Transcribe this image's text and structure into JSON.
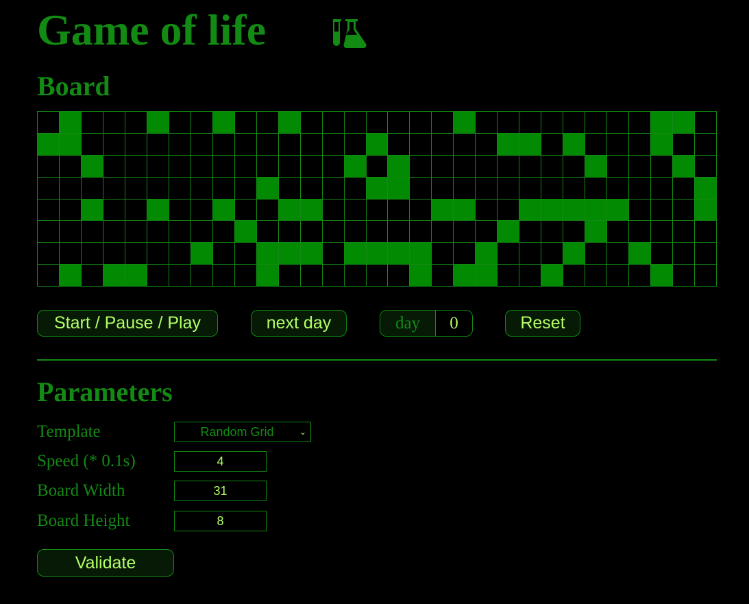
{
  "app": {
    "title": "Game of life",
    "icon": "flask-icon"
  },
  "board": {
    "title": "Board",
    "width": 31,
    "height": 8,
    "colors": {
      "alive": "#038a03",
      "dead": "#000000",
      "grid": "#138a13"
    },
    "rows": [
      "0100010010010000000100000000110000",
      "1100000000000001000001101000100000",
      "0010000000000010100000000100010010",
      "0000000000100001100000000000001100",
      "0010010010011000001100111110001000",
      "0000000001000000000001000100000000",
      "0000000100111011110010001001000000",
      "0101100000100000010110010000100101"
    ]
  },
  "controls": {
    "start_label": "Start / Pause / Play",
    "next_day_label": "next day",
    "day_label": "day",
    "day_value": "0",
    "reset_label": "Reset"
  },
  "parameters": {
    "title": "Parameters",
    "template_label": "Template",
    "template_value": "Random Grid",
    "speed_label": "Speed (* 0.1s)",
    "speed_value": "4",
    "width_label": "Board Width",
    "width_value": "31",
    "height_label": "Board Height",
    "height_value": "8",
    "validate_label": "Validate"
  },
  "colors": {
    "background": "#000000",
    "accent": "#138a13",
    "button_text": "#b3ff66"
  }
}
